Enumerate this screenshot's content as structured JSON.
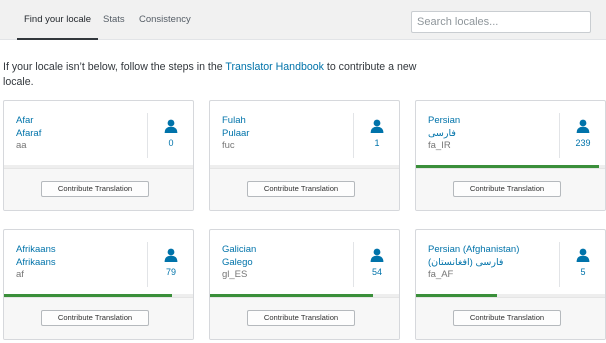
{
  "tabs": [
    {
      "label": "Find your locale",
      "active": true
    },
    {
      "label": "Stats",
      "active": false
    },
    {
      "label": "Consistency",
      "active": false
    }
  ],
  "search": {
    "placeholder": "Search locales..."
  },
  "intro": {
    "before": "If your locale isn’t below, follow the steps in the ",
    "link": "Translator Handbook",
    "after": " to contribute a new locale."
  },
  "icon_color": "#0073aa",
  "progress_color": "#3a8f3a",
  "locales": [
    {
      "english": "Afar",
      "native": "Afaraf",
      "code": "aa",
      "contributors": "0",
      "progress": 0,
      "button": "Contribute Translation"
    },
    {
      "english": "Fulah",
      "native": "Pulaar",
      "code": "fuc",
      "contributors": "1",
      "progress": 0,
      "button": "Contribute Translation"
    },
    {
      "english": "Persian",
      "native": "فارسی",
      "code": "fa_IR",
      "contributors": "239",
      "progress": 0.97,
      "button": "Contribute Translation"
    },
    {
      "english": "Afrikaans",
      "native": "Afrikaans",
      "code": "af",
      "contributors": "79",
      "progress": 0.89,
      "button": "Contribute Translation"
    },
    {
      "english": "Galician",
      "native": "Galego",
      "code": "gl_ES",
      "contributors": "54",
      "progress": 0.86,
      "button": "Contribute Translation"
    },
    {
      "english": "Persian (Afghanistan)",
      "native": "(فارسی (افغانستان",
      "code": "fa_AF",
      "contributors": "5",
      "progress": 0.43,
      "button": "Contribute Translation"
    }
  ]
}
